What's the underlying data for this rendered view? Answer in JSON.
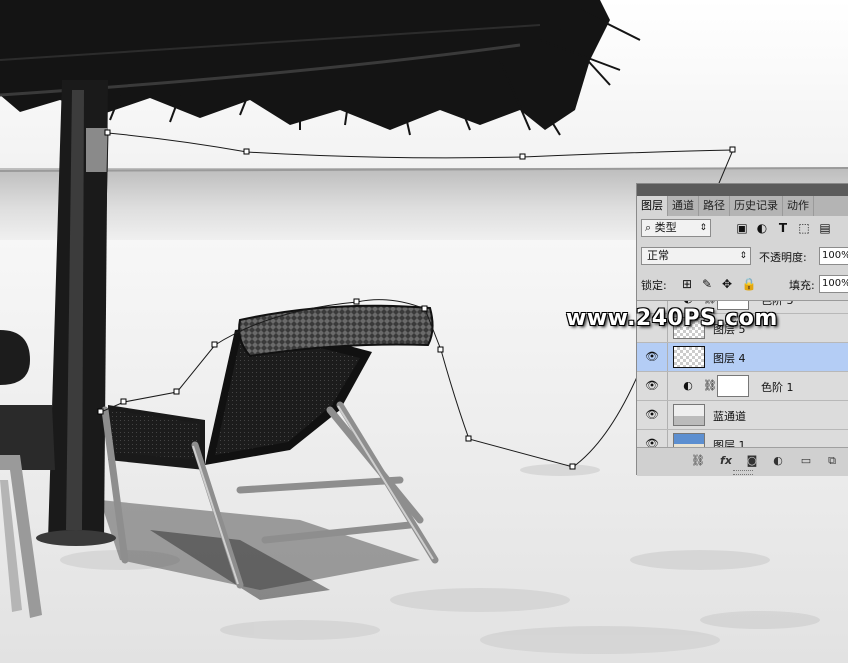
{
  "watermark": "www.240PS.com",
  "layers_panel": {
    "tabs": [
      "图层",
      "通道",
      "路径",
      "历史记录",
      "动作"
    ],
    "active_tab": 0,
    "filter": {
      "kind_label": "类型",
      "arrow": "⇕"
    },
    "filter_icons": [
      "image-filter-icon",
      "adjustment-filter-icon",
      "type-filter-icon",
      "shape-filter-icon",
      "smart-object-filter-icon"
    ],
    "blend_mode": "正常",
    "opacity_label": "不透明度:",
    "opacity_value": "100%",
    "lock_label": "锁定:",
    "lock_icons": [
      "lock-transparent-pixels-icon",
      "lock-image-pixels-icon",
      "lock-position-icon",
      "lock-all-icon"
    ],
    "fill_label": "填充:",
    "fill_value": "100%",
    "layers": [
      {
        "name": "色阶 3",
        "type": "adjustment",
        "visible": false,
        "selected": false
      },
      {
        "name": "图层 5",
        "type": "pixel",
        "visible": false,
        "selected": false
      },
      {
        "name": "图层 4",
        "type": "pixel-empty",
        "visible": true,
        "selected": true
      },
      {
        "name": "色阶 1",
        "type": "adjustment",
        "visible": true,
        "selected": false
      },
      {
        "name": "蓝通道",
        "type": "photo-gray",
        "visible": true,
        "selected": false
      },
      {
        "name": "图层 1",
        "type": "photo-color",
        "visible": true,
        "selected": false
      }
    ],
    "footer_icons": [
      "link-layers-icon",
      "fx-icon",
      "layer-mask-icon",
      "new-adjustment-icon",
      "new-group-icon",
      "new-layer-icon"
    ],
    "footer_fx_label": "fx"
  }
}
